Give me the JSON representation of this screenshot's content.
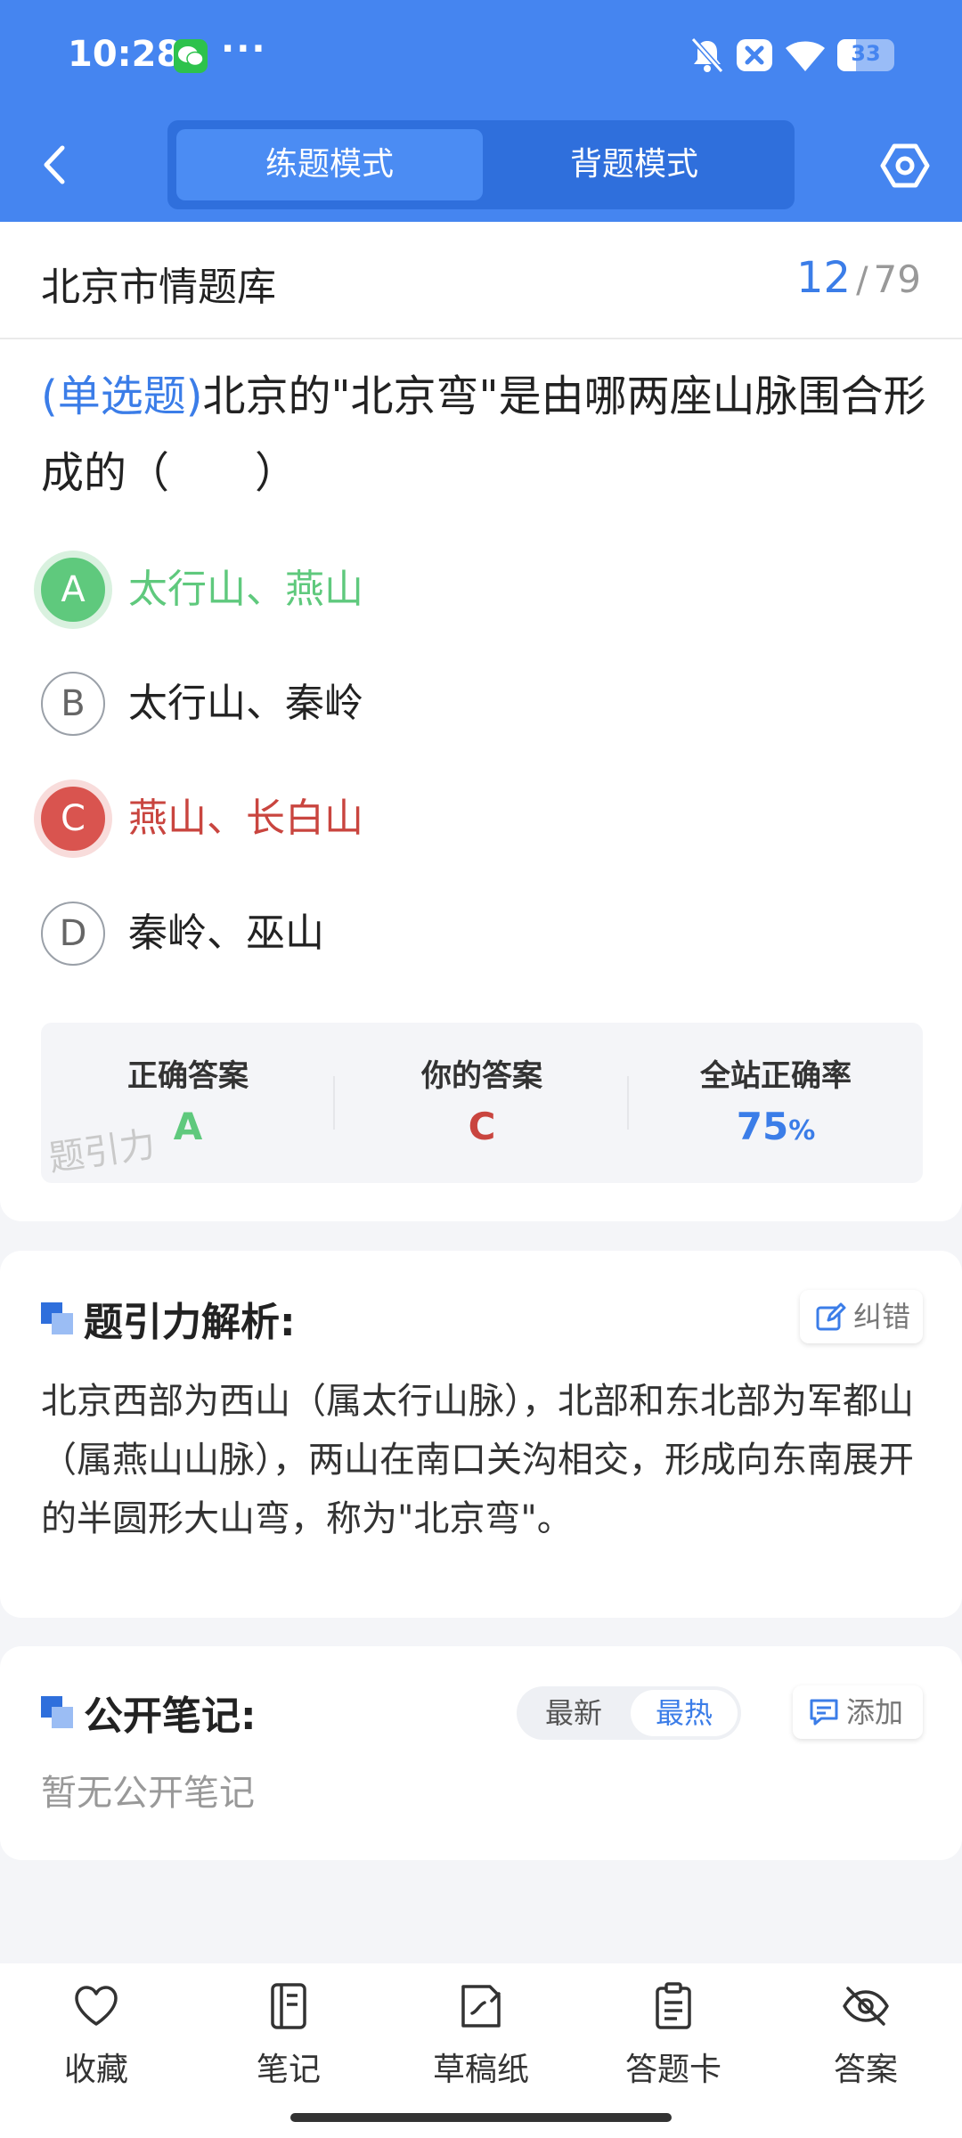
{
  "status_bar": {
    "time": "10:28",
    "more": "···",
    "battery": "33",
    "battery_level": 0.33,
    "icons": [
      "wechat-icon",
      "mute-bell-icon",
      "close-box-icon",
      "wifi-icon",
      "battery-icon"
    ]
  },
  "header": {
    "tabs": [
      {
        "label": "练题模式",
        "active": true
      },
      {
        "label": "背题模式",
        "active": false
      }
    ],
    "colors": {
      "primary": "#4585f0",
      "tab_track": "#2f6fdc"
    }
  },
  "question_bank": {
    "title": "北京市情题库",
    "current": "12",
    "separator": "/",
    "total": "79"
  },
  "question": {
    "type_label": "(单选题)",
    "text": "北京的\"北京弯\"是由哪两座山脉围合形成的（　　）",
    "options": [
      {
        "letter": "A",
        "text": "太行山、燕山",
        "state": "correct"
      },
      {
        "letter": "B",
        "text": "太行山、秦岭",
        "state": "normal"
      },
      {
        "letter": "C",
        "text": "燕山、长白山",
        "state": "wrong"
      },
      {
        "letter": "D",
        "text": "秦岭、巫山",
        "state": "normal"
      }
    ]
  },
  "answer_summary": {
    "correct_label": "正确答案",
    "correct_value": "A",
    "yours_label": "你的答案",
    "yours_value": "C",
    "rate_label": "全站正确率",
    "rate_value": "75",
    "rate_unit": "%",
    "watermark": "题引力",
    "colors": {
      "correct": "#5fc97d",
      "wrong": "#c9453f",
      "rate": "#3b7de8"
    }
  },
  "analysis": {
    "title": "题引力解析:",
    "report_label": "纠错",
    "text": "北京西部为西山（属太行山脉），北部和东北部为军都山（属燕山山脉），两山在南口关沟相交，形成向东南展开的半圆形大山弯，称为\"北京弯\"。"
  },
  "notes": {
    "title": "公开笔记:",
    "sort_latest": "最新",
    "sort_hot": "最热",
    "add_label": "添加",
    "empty_text": "暂无公开笔记"
  },
  "bottom_nav": [
    {
      "label": "收藏",
      "icon": "heart-icon"
    },
    {
      "label": "笔记",
      "icon": "notebook-icon"
    },
    {
      "label": "草稿纸",
      "icon": "draft-paper-icon"
    },
    {
      "label": "答题卡",
      "icon": "answer-sheet-icon"
    },
    {
      "label": "答案",
      "icon": "eye-off-icon"
    }
  ]
}
